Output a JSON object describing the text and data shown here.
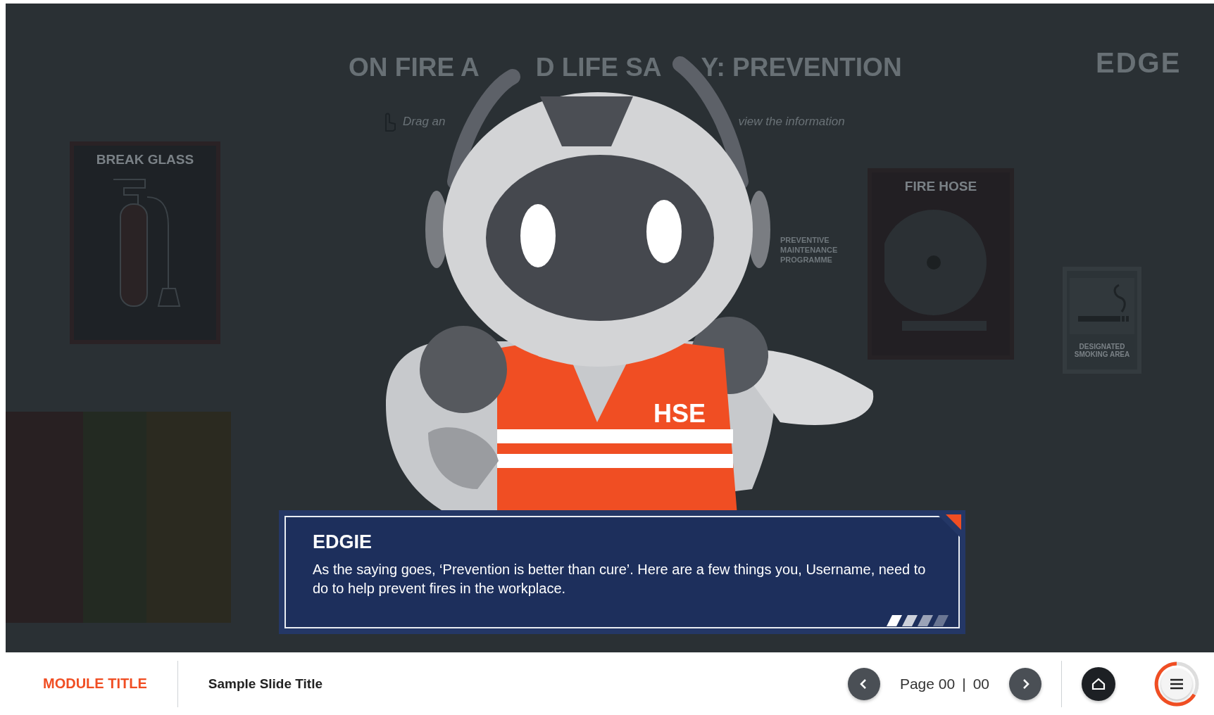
{
  "scene": {
    "title_parts": [
      "ON FIRE A",
      "D LIFE SA",
      "Y: PREVENTION"
    ],
    "instruction_parts": [
      "Drag an",
      "view the information"
    ],
    "logo": "EDGE",
    "posters": [
      {
        "kind": "extinguisher",
        "label": "BREAK GLASS"
      },
      {
        "kind": "hose",
        "label": "FIRE HOSE"
      },
      {
        "kind": "smoking",
        "label": "DESIGNATED SMOKING AREA"
      }
    ],
    "note": "PREVENTIVE MAINTENANCE PROGRAMME"
  },
  "character": {
    "vest_label": "HSE"
  },
  "dialog": {
    "speaker": "EDGIE",
    "text": "As the saying goes, ‘Prevention is better than cure’. Here are a few things you, Username, need to do to help prevent fires in the workplace."
  },
  "footer": {
    "module_title": "MODULE TITLE",
    "slide_title": "Sample Slide Title",
    "page_label": "Page 00",
    "page_separator": "|",
    "page_total": "00"
  }
}
